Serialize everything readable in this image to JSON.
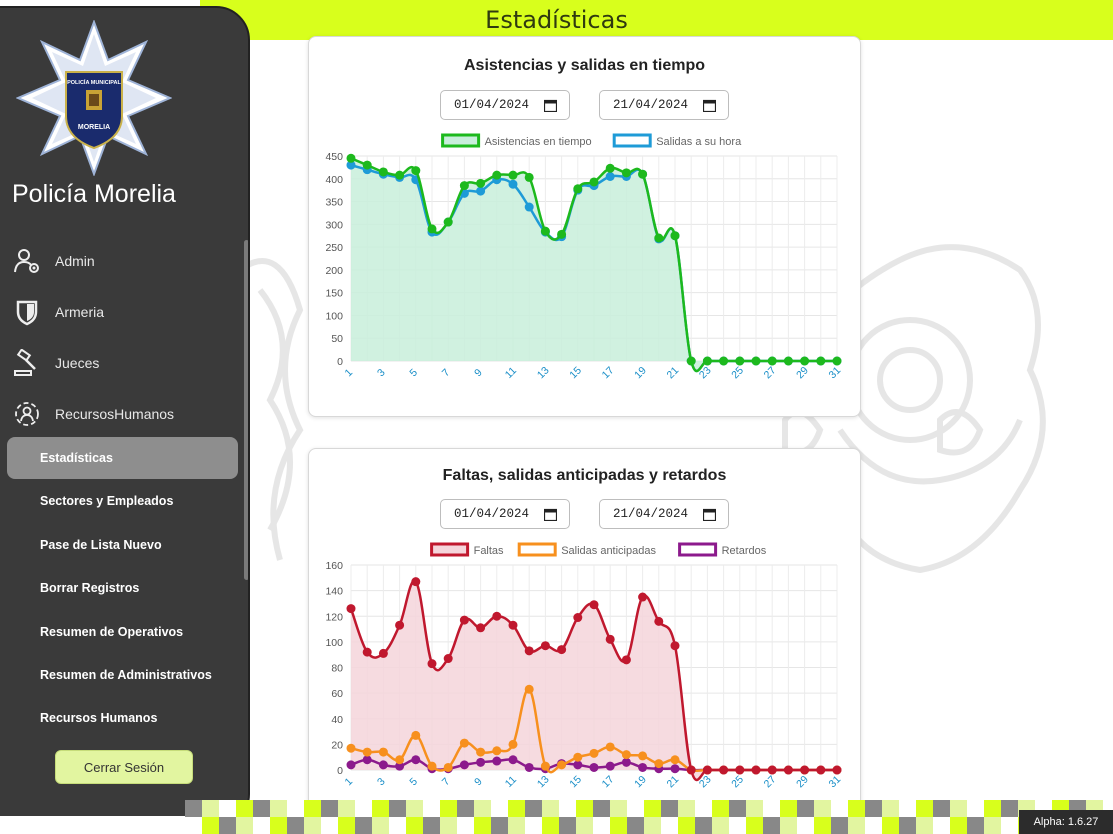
{
  "header": {
    "title": "Estadísticas"
  },
  "sidebar": {
    "brand": "Policía Morelia",
    "badge": {
      "top_text": "POLICÍA MUNICIPAL",
      "bottom_text": "MORELIA"
    },
    "nav": [
      {
        "label": "Admin",
        "icon": "user-gear-icon"
      },
      {
        "label": "Armeria",
        "icon": "shield-icon"
      },
      {
        "label": "Jueces",
        "icon": "gavel-icon"
      },
      {
        "label": "RecursosHumanos",
        "icon": "people-circle-icon"
      }
    ],
    "sub_items": [
      {
        "label": "Estadísticas",
        "active": true
      },
      {
        "label": "Sectores y Empleados"
      },
      {
        "label": "Pase de Lista Nuevo"
      },
      {
        "label": "Borrar Registros"
      },
      {
        "label": "Resumen de Operativos"
      },
      {
        "label": "Resumen de Administrativos"
      },
      {
        "label": "Recursos Humanos"
      }
    ],
    "logout_label": "Cerrar Sesión"
  },
  "version": "Alpha: 1.6.27",
  "charts": [
    {
      "title": "Asistencias y salidas en tiempo",
      "date_from": "01/04/2024",
      "date_to": "21/04/2024"
    },
    {
      "title": "Faltas, salidas anticipadas y retardos",
      "date_from": "01/04/2024",
      "date_to": "21/04/2024"
    }
  ],
  "chart_data": [
    {
      "type": "line",
      "title": "Asistencias y salidas en tiempo",
      "x": [
        1,
        2,
        3,
        4,
        5,
        6,
        7,
        8,
        9,
        10,
        11,
        12,
        13,
        14,
        15,
        16,
        17,
        18,
        19,
        20,
        21,
        22,
        23,
        24,
        25,
        26,
        27,
        28,
        29,
        30,
        31
      ],
      "x_tick_labels": [
        "1",
        "3",
        "5",
        "7",
        "9",
        "11",
        "13",
        "15",
        "17",
        "19",
        "21",
        "23",
        "25",
        "27",
        "29",
        "31"
      ],
      "ylim": [
        0,
        450
      ],
      "y_ticks": [
        0,
        50,
        100,
        150,
        200,
        250,
        300,
        350,
        400,
        450
      ],
      "grid": true,
      "legend_position": "top",
      "series": [
        {
          "name": "Asistencias en tiempo",
          "color": "#1db91d",
          "fill": "#c8eedb",
          "values": [
            445,
            430,
            415,
            408,
            418,
            290,
            305,
            385,
            390,
            408,
            408,
            403,
            285,
            278,
            378,
            393,
            423,
            413,
            410,
            270,
            275,
            0,
            0,
            0,
            0,
            0,
            0,
            0,
            0,
            0,
            0
          ]
        },
        {
          "name": "Salidas a su hora",
          "color": "#1e9bd7",
          "fill": "none",
          "values": [
            430,
            420,
            410,
            403,
            398,
            283,
            305,
            368,
            373,
            398,
            388,
            338,
            283,
            273,
            375,
            385,
            405,
            405,
            410,
            268,
            275,
            0,
            0,
            0,
            0,
            0,
            0,
            0,
            0,
            0,
            0
          ]
        }
      ]
    },
    {
      "type": "line",
      "title": "Faltas, salidas anticipadas y retardos",
      "x": [
        1,
        2,
        3,
        4,
        5,
        6,
        7,
        8,
        9,
        10,
        11,
        12,
        13,
        14,
        15,
        16,
        17,
        18,
        19,
        20,
        21,
        22,
        23,
        24,
        25,
        26,
        27,
        28,
        29,
        30,
        31
      ],
      "x_tick_labels": [
        "1",
        "3",
        "5",
        "7",
        "9",
        "11",
        "13",
        "15",
        "17",
        "19",
        "21",
        "23",
        "25",
        "27",
        "29",
        "31"
      ],
      "ylim": [
        0,
        160
      ],
      "y_ticks": [
        0,
        20,
        40,
        60,
        80,
        100,
        120,
        140,
        160
      ],
      "grid": true,
      "legend_position": "top",
      "series": [
        {
          "name": "Faltas",
          "color": "#c0182e",
          "fill": "#f5d5db",
          "values": [
            126,
            92,
            91,
            113,
            147,
            83,
            87,
            117,
            111,
            120,
            113,
            93,
            97,
            94,
            119,
            129,
            102,
            86,
            135,
            116,
            97,
            0,
            0,
            0,
            0,
            0,
            0,
            0,
            0,
            0,
            0
          ]
        },
        {
          "name": "Salidas anticipadas",
          "color": "#f7901e",
          "fill": "none",
          "values": [
            17,
            14,
            14,
            8,
            27,
            3,
            2,
            21,
            14,
            15,
            20,
            63,
            3,
            4,
            10,
            13,
            18,
            12,
            11,
            5,
            8,
            0,
            0,
            0,
            0,
            0,
            0,
            0,
            0,
            0,
            0
          ]
        },
        {
          "name": "Retardos",
          "color": "#8c1a8c",
          "fill": "none",
          "values": [
            4,
            8,
            4,
            3,
            8,
            1,
            1,
            4,
            6,
            7,
            8,
            2,
            1,
            5,
            4,
            2,
            3,
            6,
            2,
            1,
            1,
            0,
            0,
            0,
            0,
            0,
            0,
            0,
            0,
            0,
            0
          ]
        }
      ]
    }
  ]
}
